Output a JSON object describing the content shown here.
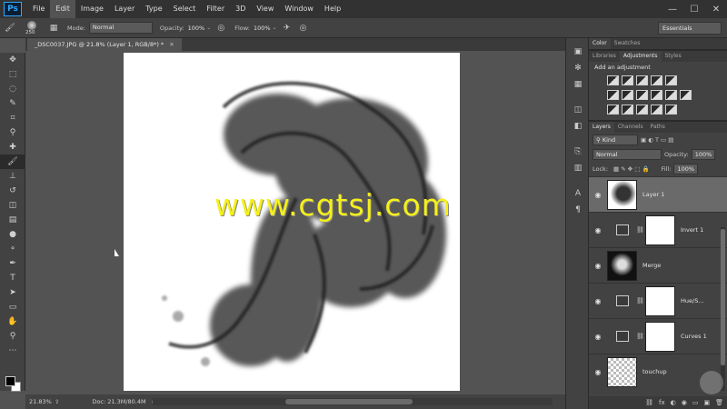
{
  "app": {
    "logo": "Ps",
    "menu": [
      "File",
      "Edit",
      "Image",
      "Layer",
      "Type",
      "Select",
      "Filter",
      "3D",
      "View",
      "Window",
      "Help"
    ],
    "active_menu": "Edit",
    "window_controls": [
      "—",
      "☐",
      "✕"
    ]
  },
  "options_bar": {
    "brush_size": "250",
    "mode_label": "Mode:",
    "mode_value": "Normal",
    "opacity_label": "Opacity:",
    "opacity_value": "100%",
    "flow_label": "Flow:",
    "flow_value": "100%",
    "workspace": "Essentials"
  },
  "document": {
    "tab_title": "_DSC0037.JPG @ 21.8% (Layer 1, RGB/8*) *",
    "watermark": "www.cgtsj.com"
  },
  "status": {
    "zoom": "21.83%",
    "doc_size": "Doc: 21.3M/80.4M"
  },
  "panels": {
    "top_tabs": [
      "Color",
      "Swatches"
    ],
    "adj_tabs": [
      "Libraries",
      "Adjustments",
      "Styles"
    ],
    "adj_title": "Add an adjustment",
    "layer_tabs": [
      "Layers",
      "Channels",
      "Paths"
    ],
    "kind": "Kind",
    "blend": "Normal",
    "opacity_label": "Opacity:",
    "opacity_value": "100%",
    "lock_label": "Lock:",
    "fill_label": "Fill:",
    "fill_value": "100%",
    "layers": [
      {
        "name": "Layer 1",
        "type": "pixel",
        "selected": true
      },
      {
        "name": "Invert 1",
        "type": "adjustment"
      },
      {
        "name": "Merge",
        "type": "pixel-dark"
      },
      {
        "name": "Hue/S...",
        "type": "adjustment"
      },
      {
        "name": "Curves 1",
        "type": "adjustment"
      },
      {
        "name": "touchup",
        "type": "pixel-check"
      }
    ],
    "bottom_icons": [
      "⛓",
      "fx",
      "◐",
      "◉",
      "▭",
      "▣",
      "🗑"
    ]
  },
  "colors": {
    "ps_blue": "#31a8ff",
    "watermark": "#f5f01a",
    "foreground": "#000000",
    "background": "#ffffff"
  }
}
